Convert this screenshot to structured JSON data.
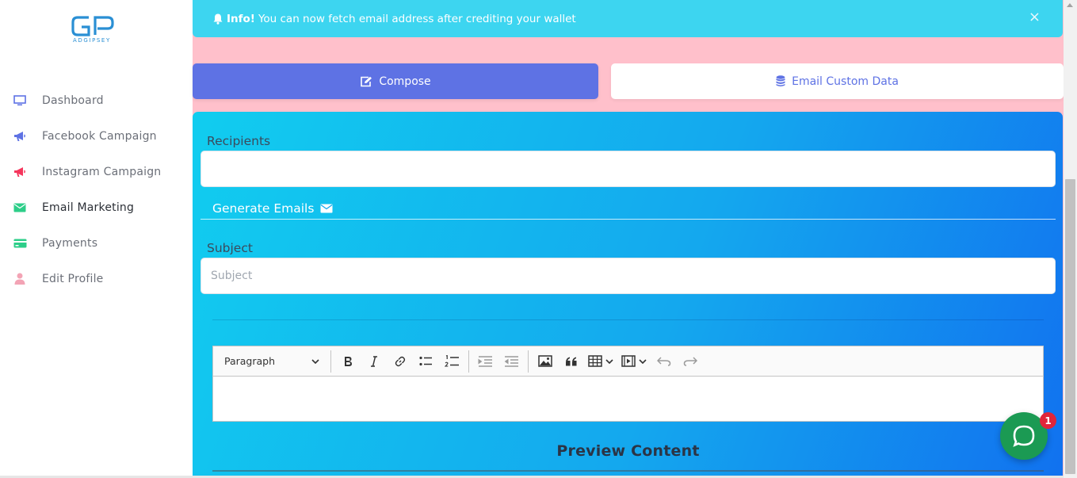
{
  "brand": {
    "name": "ADGIPSEY"
  },
  "sidebar": {
    "items": [
      {
        "label": "Dashboard",
        "icon": "monitor-icon",
        "color": "#5e72e4"
      },
      {
        "label": "Facebook Campaign",
        "icon": "megaphone-icon",
        "color": "#5e72e4"
      },
      {
        "label": "Instagram Campaign",
        "icon": "megaphone-icon",
        "color": "#f5365c"
      },
      {
        "label": "Email Marketing",
        "icon": "envelope-icon",
        "color": "#2dce89",
        "active": true
      },
      {
        "label": "Payments",
        "icon": "credit-card-icon",
        "color": "#2dce89"
      },
      {
        "label": "Edit Profile",
        "icon": "user-icon",
        "color": "#f3a4b5"
      }
    ]
  },
  "alert": {
    "title": "Info!",
    "message": "You can now fetch email address after crediting your wallet",
    "close": "×",
    "color": "#3dd5f0"
  },
  "actions": {
    "compose": "Compose",
    "custom_data": "Email Custom Data"
  },
  "form": {
    "recipients_label": "Recipients",
    "recipients_value": "",
    "generate_emails": "Generate Emails",
    "subject_label": "Subject",
    "subject_placeholder": "Subject",
    "paragraph_select": "Paragraph",
    "preview_title": "Preview Content"
  },
  "chat": {
    "badge_count": "1"
  },
  "colors": {
    "primary": "#5e72e4",
    "gradient_start": "#11cdef",
    "gradient_end": "#1171ef",
    "page_bg": "#ffc0cb",
    "chat": "#1b9a53",
    "badge": "#e0253a"
  }
}
